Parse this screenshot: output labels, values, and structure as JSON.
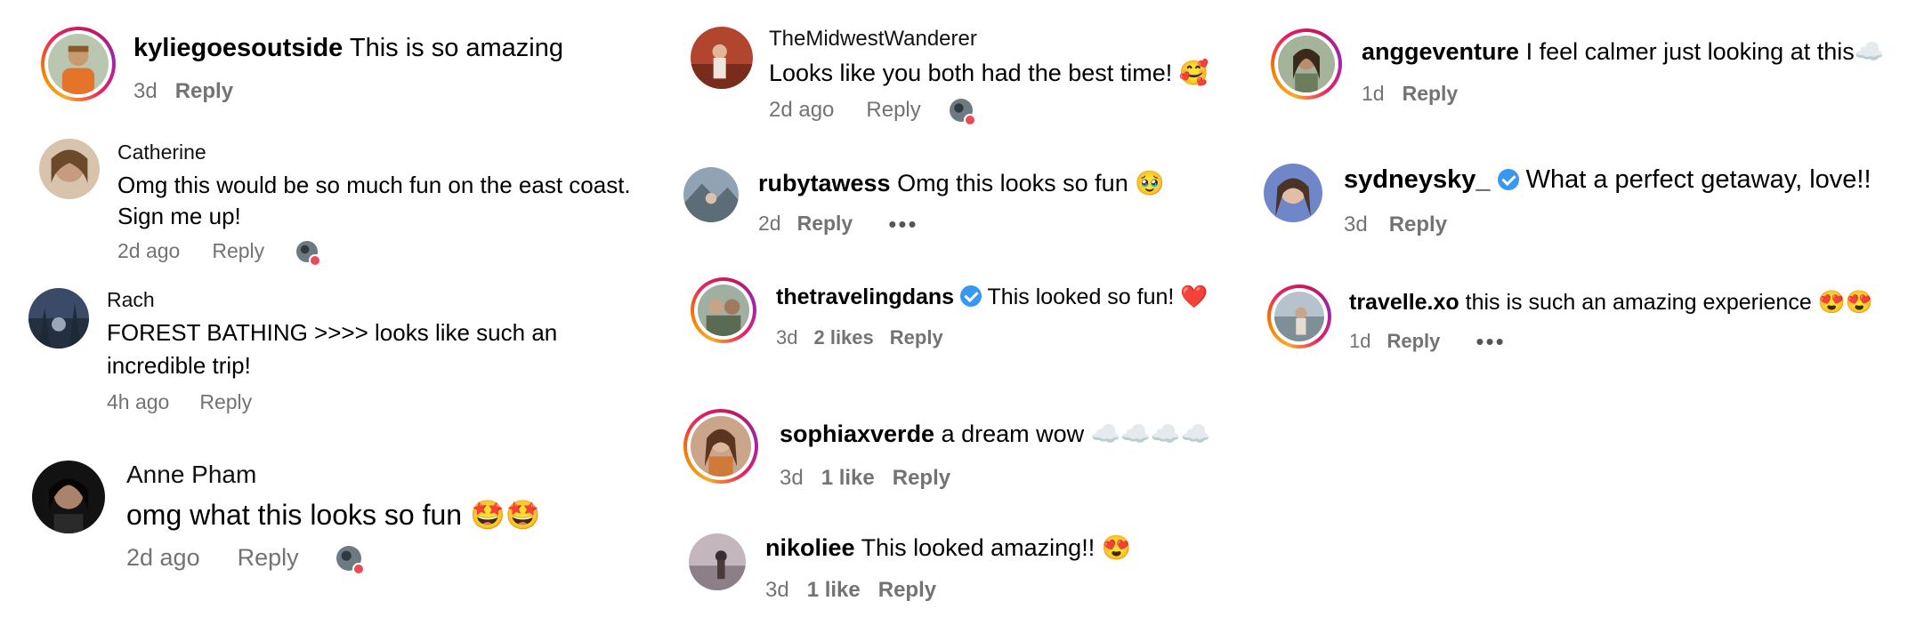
{
  "colors": {
    "text": "#000000",
    "meta": "#737373",
    "verified": "#3897f0",
    "heart_badge": "#ed4956"
  },
  "comments": [
    {
      "username": "kyliegoesoutside",
      "text": "This is so amazing",
      "time": "3d",
      "reply": "Reply"
    },
    {
      "username": "Catherine",
      "text_line1": "Omg this would be so much fun on the east coast.",
      "text_line2": "Sign me up!",
      "time": "2d ago",
      "reply": "Reply"
    },
    {
      "username": "Rach",
      "text_line1": "FOREST BATHING >>>> looks like such an",
      "text_line2": "incredible trip!",
      "time": "4h ago",
      "reply": "Reply"
    },
    {
      "username": "Anne Pham",
      "text": "omg what this looks so fun 🤩🤩",
      "time": "2d ago",
      "reply": "Reply"
    },
    {
      "username": "TheMidwestWanderer",
      "text": "Looks like you both had the best time! 🥰",
      "time": "2d ago",
      "reply": "Reply"
    },
    {
      "username": "rubytawess",
      "text": "Omg this looks so fun 🥹",
      "time": "2d",
      "reply": "Reply",
      "more": "•••"
    },
    {
      "username": "thetravelingdans",
      "text": "This looked so fun! ❤️",
      "time": "3d",
      "likes": "2 likes",
      "reply": "Reply"
    },
    {
      "username": "sophiaxverde",
      "text": "a dream wow ☁️☁️☁️☁️",
      "time": "3d",
      "likes": "1 like",
      "reply": "Reply"
    },
    {
      "username": "nikoliee",
      "text": "This looked amazing!! 😍",
      "time": "3d",
      "likes": "1 like",
      "reply": "Reply"
    },
    {
      "username": "anggeventure",
      "text": "I feel calmer just looking at this☁️",
      "time": "1d",
      "reply": "Reply"
    },
    {
      "username": "sydneysky_",
      "text": "What a perfect getaway, love!!",
      "time": "3d",
      "reply": "Reply"
    },
    {
      "username": "travelle.xo",
      "text": "this is such an amazing experience 😍😍",
      "time": "1d",
      "reply": "Reply",
      "more": "•••"
    }
  ]
}
